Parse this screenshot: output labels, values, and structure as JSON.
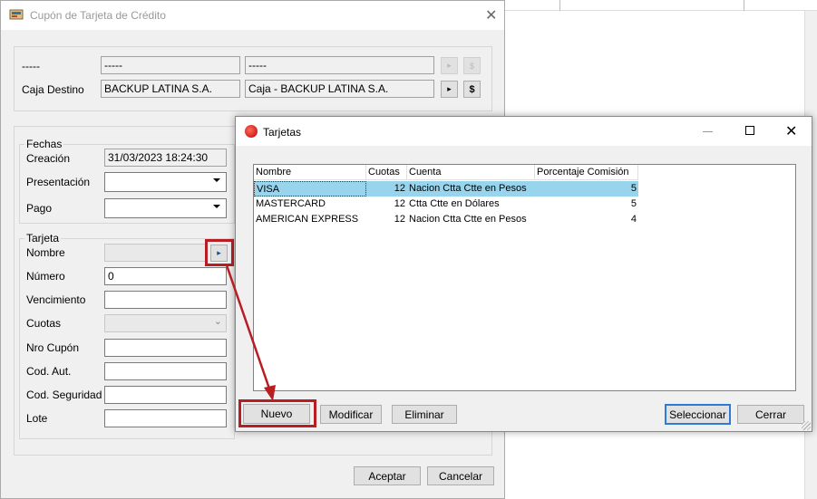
{
  "main": {
    "title": "Cupón de Tarjeta de Crédito",
    "row1": {
      "label": "-----",
      "field1": "-----",
      "field2": "-----"
    },
    "caja": {
      "label": "Caja Destino",
      "field1": "BACKUP LATINA S.A.",
      "field2": "Caja - BACKUP LATINA S.A."
    },
    "dollar": "$",
    "fechas": {
      "group": "Fechas",
      "creacion_label": "Creación",
      "creacion_value": "31/03/2023 18:24:30",
      "presentacion_label": "Presentación",
      "pago_label": "Pago"
    },
    "tarjeta": {
      "group": "Tarjeta",
      "nombre_label": "Nombre",
      "numero_label": "Número",
      "numero_value": "0",
      "vencimiento_label": "Vencimiento",
      "cuotas_label": "Cuotas",
      "nro_cupon_label": "Nro Cupón",
      "cod_aut_label": "Cod. Aut.",
      "cod_seg_label": "Cod. Seguridad",
      "lote_label": "Lote"
    },
    "aceptar": "Aceptar",
    "cancelar": "Cancelar"
  },
  "tarjetas": {
    "title": "Tarjetas",
    "columns": [
      "Nombre",
      "Cuotas",
      "Cuenta",
      "Porcentaje Comisión"
    ],
    "rows": [
      {
        "nombre": "VISA",
        "cuotas": "12",
        "cuenta": "Nacion Ctta Ctte en Pesos",
        "comision": "5",
        "selected": true
      },
      {
        "nombre": "MASTERCARD",
        "cuotas": "12",
        "cuenta": "Ctta Ctte en Dólares",
        "comision": "5",
        "selected": false
      },
      {
        "nombre": "AMERICAN EXPRESS",
        "cuotas": "12",
        "cuenta": "Nacion Ctta Ctte en Pesos",
        "comision": "4",
        "selected": false
      }
    ],
    "nuevo": "Nuevo",
    "modificar": "Modificar",
    "eliminar": "Eliminar",
    "seleccionar": "Seleccionar",
    "cerrar": "Cerrar"
  },
  "colors": {
    "highlight": "#b81d24",
    "selection": "#99d4ed",
    "focus": "#2c7bd6"
  }
}
